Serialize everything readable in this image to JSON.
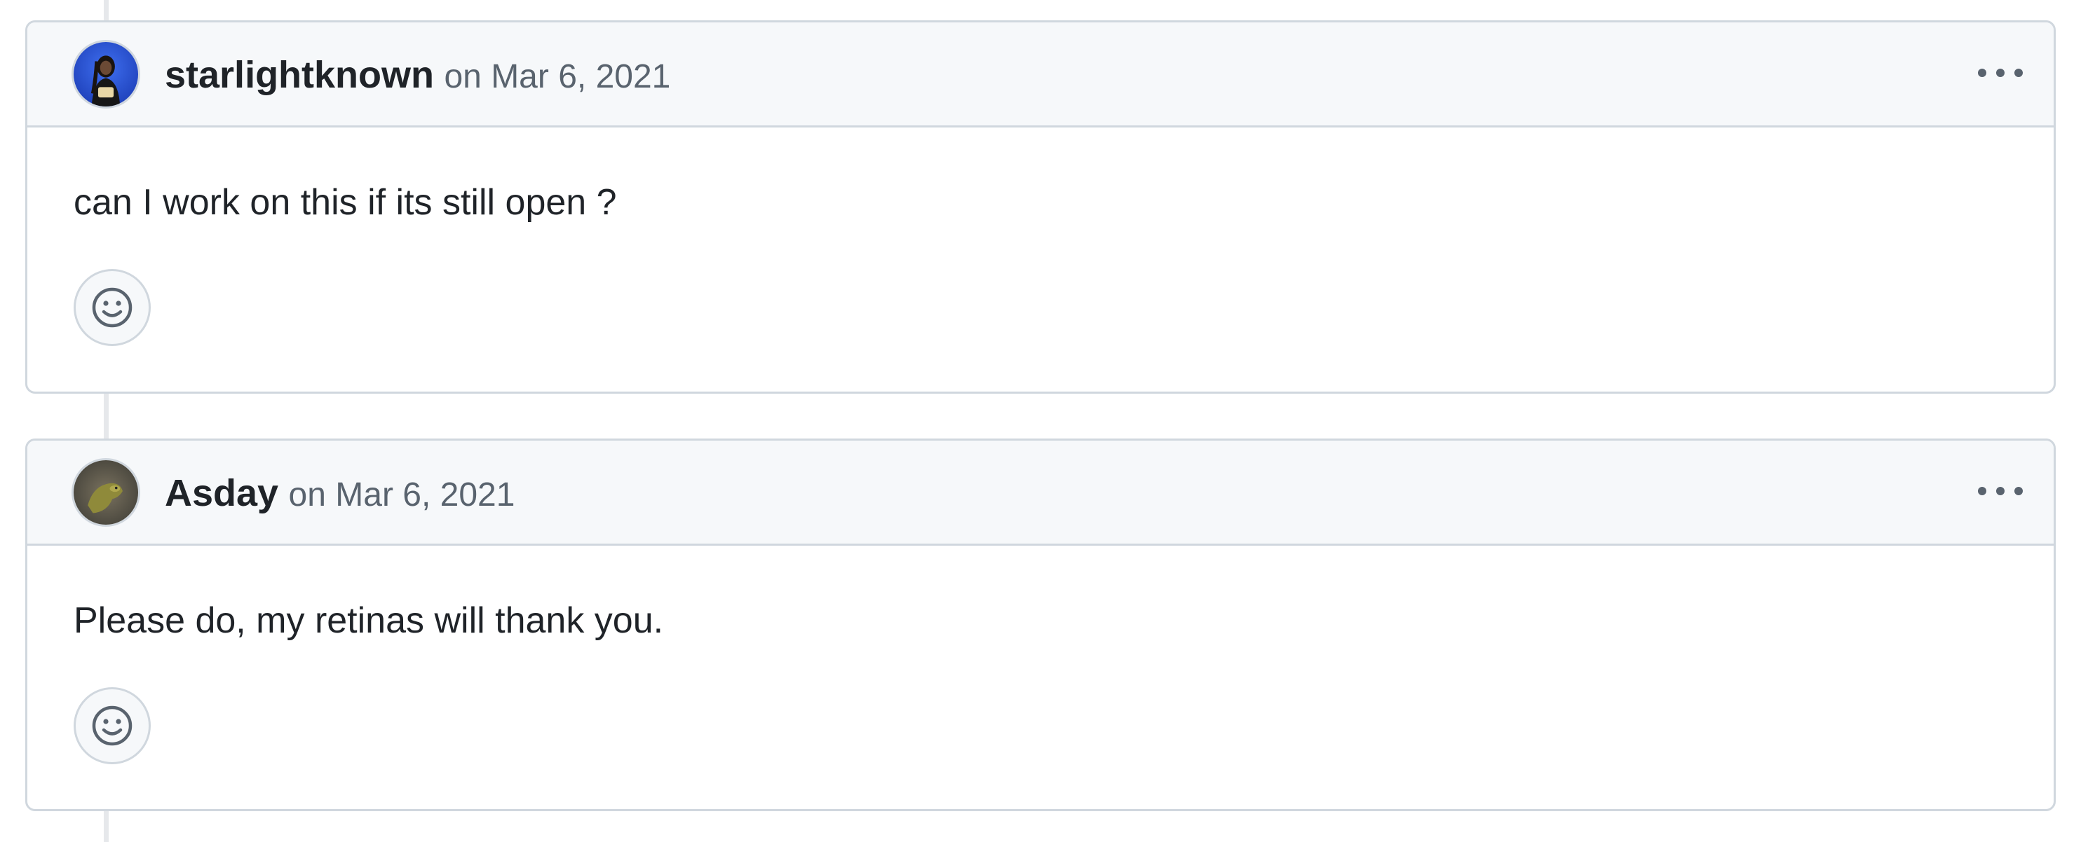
{
  "comments": [
    {
      "author": "starlightknown",
      "timestamp": "on Mar 6, 2021",
      "body": "can I work on this if its still open ?",
      "avatar_icon": "user-avatar-photo",
      "menu_icon": "kebab-horizontal-icon",
      "reaction_icon": "smiley-icon"
    },
    {
      "author": "Asday",
      "timestamp": "on Mar 6, 2021",
      "body": "Please do, my retinas will thank you.",
      "avatar_icon": "user-avatar-photo",
      "menu_icon": "kebab-horizontal-icon",
      "reaction_icon": "smiley-icon"
    }
  ],
  "colors": {
    "header_bg": "#f6f8fa",
    "border": "#d0d7de",
    "text": "#1f2328",
    "muted": "#59636e",
    "timeline": "#e6e8eb"
  }
}
